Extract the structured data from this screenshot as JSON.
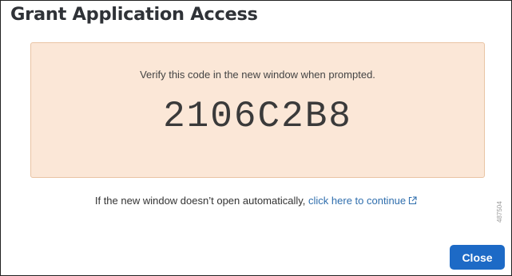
{
  "dialog": {
    "title": "Grant Application Access"
  },
  "code_panel": {
    "instruction": "Verify this code in the new window when prompted.",
    "code": "2106C2B8",
    "background_color": "#fbe7d7"
  },
  "fallback": {
    "text": "If the new window doesn’t open automatically,",
    "link_label": "click here to continue",
    "link_icon": "external-link-icon",
    "link_color": "#2f6ead"
  },
  "watermark": {
    "text": "487504"
  },
  "actions": {
    "close_label": "Close",
    "close_color": "#1d6ac6"
  }
}
